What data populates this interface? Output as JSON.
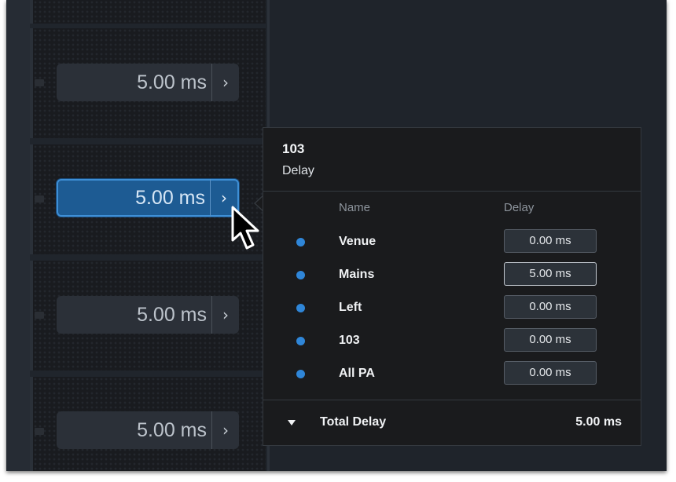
{
  "delay_buttons": [
    {
      "value": "5.00 ms",
      "chevron": "›",
      "selected": false
    },
    {
      "value": "5.00 ms",
      "chevron": "›",
      "selected": true
    },
    {
      "value": "5.00 ms",
      "chevron": "›",
      "selected": false
    },
    {
      "value": "5.00 ms",
      "chevron": "›",
      "selected": false
    }
  ],
  "popover": {
    "title": "103",
    "subtitle": "Delay",
    "columns": {
      "name": "Name",
      "delay": "Delay"
    },
    "rows": [
      {
        "name": "Venue",
        "delay": "0.00 ms"
      },
      {
        "name": "Mains",
        "delay": "5.00 ms"
      },
      {
        "name": "Left",
        "delay": "0.00 ms"
      },
      {
        "name": "103",
        "delay": "0.00 ms"
      },
      {
        "name": "All PA",
        "delay": "0.00 ms"
      }
    ],
    "total": {
      "label": "Total Delay",
      "value": "5.00 ms"
    }
  },
  "colors": {
    "accent": "#1d5b93",
    "accent_border": "#3e8fd6",
    "dot": "#2f86d8",
    "background": "#1f242b"
  },
  "icons": {
    "chevron": "chevron-right-icon",
    "dot": "dot-icon",
    "collapse": "triangle-down-icon",
    "cursor": "mouse-pointer-icon"
  }
}
